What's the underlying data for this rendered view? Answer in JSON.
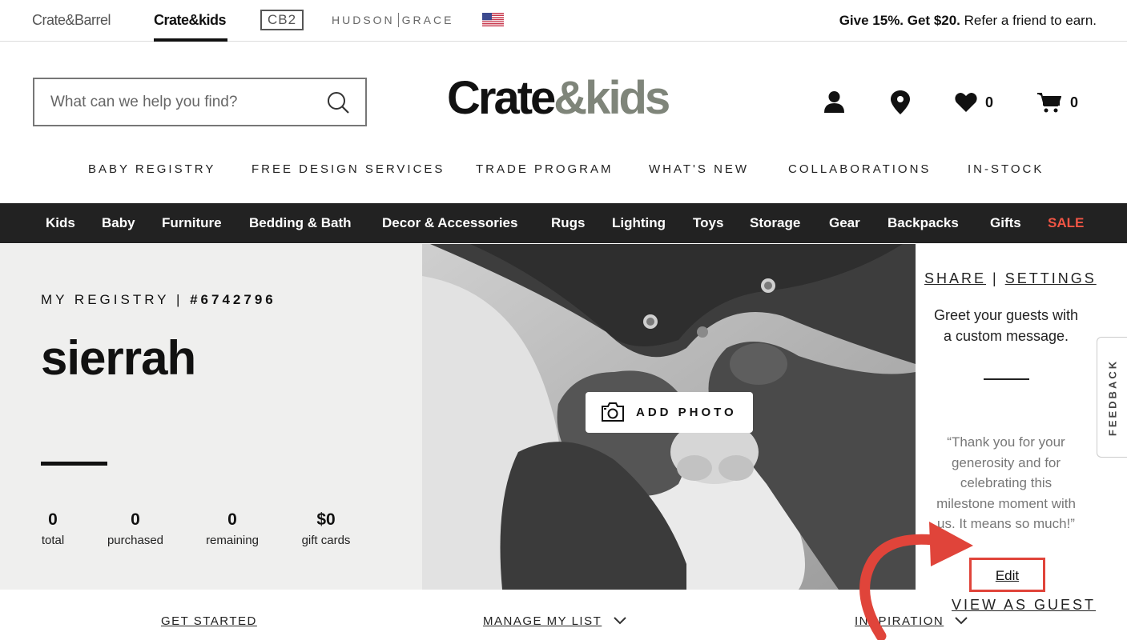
{
  "brandbar": {
    "brands": [
      "Crate&Barrel",
      "Crate&kids",
      "CB2",
      "HUDSON",
      "GRACE"
    ],
    "promo_bold": "Give 15%. Get $20.",
    "promo_text": " Refer a friend to earn."
  },
  "header": {
    "search_placeholder": "What can we help you find?",
    "logo_main": "Crate",
    "logo_amp": "&kids",
    "favorites_count": "0",
    "cart_count": "0"
  },
  "utility_nav": [
    "BABY REGISTRY",
    "FREE DESIGN SERVICES",
    "TRADE PROGRAM",
    "WHAT'S NEW",
    "COLLABORATIONS",
    "IN-STOCK"
  ],
  "categories": [
    "Kids",
    "Baby",
    "Furniture",
    "Bedding & Bath",
    "Decor & Accessories",
    "Rugs",
    "Lighting",
    "Toys",
    "Storage",
    "Gear",
    "Backpacks",
    "Gifts",
    "SALE"
  ],
  "registry": {
    "heading": "MY REGISTRY",
    "separator": "|",
    "number": "#6742796",
    "name": "sierrah",
    "stats": [
      {
        "value": "0",
        "label": "total"
      },
      {
        "value": "0",
        "label": "purchased"
      },
      {
        "value": "0",
        "label": "remaining"
      },
      {
        "value": "$0",
        "label": "gift cards"
      }
    ],
    "add_photo": "ADD PHOTO"
  },
  "sidebar": {
    "share": "SHARE",
    "bar": "|",
    "settings": "SETTINGS",
    "greet": "Greet your guests with a custom message.",
    "quote": "“Thank you for your generosity and for celebrating this milestone moment with us. It means so much!”",
    "edit": "Edit",
    "view_as_guest": "VIEW AS GUEST",
    "feedback": "FEEDBACK"
  },
  "bottom_tabs": [
    "GET STARTED",
    "MANAGE MY LIST",
    "INSPIRATION"
  ],
  "colors": {
    "accent_red": "#e0443a",
    "sale_red": "#f05545",
    "logo_gray": "#7f857a",
    "catbar_bg": "#222222"
  }
}
